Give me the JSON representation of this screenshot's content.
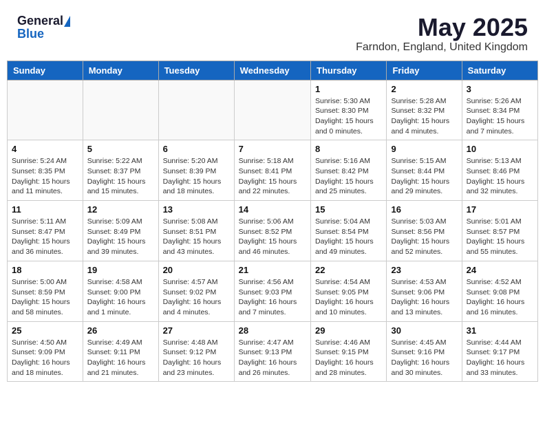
{
  "header": {
    "logo_general": "General",
    "logo_blue": "Blue",
    "month_title": "May 2025",
    "location": "Farndon, England, United Kingdom"
  },
  "weekdays": [
    "Sunday",
    "Monday",
    "Tuesday",
    "Wednesday",
    "Thursday",
    "Friday",
    "Saturday"
  ],
  "weeks": [
    [
      {
        "day": "",
        "info": ""
      },
      {
        "day": "",
        "info": ""
      },
      {
        "day": "",
        "info": ""
      },
      {
        "day": "",
        "info": ""
      },
      {
        "day": "1",
        "info": "Sunrise: 5:30 AM\nSunset: 8:30 PM\nDaylight: 15 hours and 0 minutes."
      },
      {
        "day": "2",
        "info": "Sunrise: 5:28 AM\nSunset: 8:32 PM\nDaylight: 15 hours and 4 minutes."
      },
      {
        "day": "3",
        "info": "Sunrise: 5:26 AM\nSunset: 8:34 PM\nDaylight: 15 hours and 7 minutes."
      }
    ],
    [
      {
        "day": "4",
        "info": "Sunrise: 5:24 AM\nSunset: 8:35 PM\nDaylight: 15 hours and 11 minutes."
      },
      {
        "day": "5",
        "info": "Sunrise: 5:22 AM\nSunset: 8:37 PM\nDaylight: 15 hours and 15 minutes."
      },
      {
        "day": "6",
        "info": "Sunrise: 5:20 AM\nSunset: 8:39 PM\nDaylight: 15 hours and 18 minutes."
      },
      {
        "day": "7",
        "info": "Sunrise: 5:18 AM\nSunset: 8:41 PM\nDaylight: 15 hours and 22 minutes."
      },
      {
        "day": "8",
        "info": "Sunrise: 5:16 AM\nSunset: 8:42 PM\nDaylight: 15 hours and 25 minutes."
      },
      {
        "day": "9",
        "info": "Sunrise: 5:15 AM\nSunset: 8:44 PM\nDaylight: 15 hours and 29 minutes."
      },
      {
        "day": "10",
        "info": "Sunrise: 5:13 AM\nSunset: 8:46 PM\nDaylight: 15 hours and 32 minutes."
      }
    ],
    [
      {
        "day": "11",
        "info": "Sunrise: 5:11 AM\nSunset: 8:47 PM\nDaylight: 15 hours and 36 minutes."
      },
      {
        "day": "12",
        "info": "Sunrise: 5:09 AM\nSunset: 8:49 PM\nDaylight: 15 hours and 39 minutes."
      },
      {
        "day": "13",
        "info": "Sunrise: 5:08 AM\nSunset: 8:51 PM\nDaylight: 15 hours and 43 minutes."
      },
      {
        "day": "14",
        "info": "Sunrise: 5:06 AM\nSunset: 8:52 PM\nDaylight: 15 hours and 46 minutes."
      },
      {
        "day": "15",
        "info": "Sunrise: 5:04 AM\nSunset: 8:54 PM\nDaylight: 15 hours and 49 minutes."
      },
      {
        "day": "16",
        "info": "Sunrise: 5:03 AM\nSunset: 8:56 PM\nDaylight: 15 hours and 52 minutes."
      },
      {
        "day": "17",
        "info": "Sunrise: 5:01 AM\nSunset: 8:57 PM\nDaylight: 15 hours and 55 minutes."
      }
    ],
    [
      {
        "day": "18",
        "info": "Sunrise: 5:00 AM\nSunset: 8:59 PM\nDaylight: 15 hours and 58 minutes."
      },
      {
        "day": "19",
        "info": "Sunrise: 4:58 AM\nSunset: 9:00 PM\nDaylight: 16 hours and 1 minute."
      },
      {
        "day": "20",
        "info": "Sunrise: 4:57 AM\nSunset: 9:02 PM\nDaylight: 16 hours and 4 minutes."
      },
      {
        "day": "21",
        "info": "Sunrise: 4:56 AM\nSunset: 9:03 PM\nDaylight: 16 hours and 7 minutes."
      },
      {
        "day": "22",
        "info": "Sunrise: 4:54 AM\nSunset: 9:05 PM\nDaylight: 16 hours and 10 minutes."
      },
      {
        "day": "23",
        "info": "Sunrise: 4:53 AM\nSunset: 9:06 PM\nDaylight: 16 hours and 13 minutes."
      },
      {
        "day": "24",
        "info": "Sunrise: 4:52 AM\nSunset: 9:08 PM\nDaylight: 16 hours and 16 minutes."
      }
    ],
    [
      {
        "day": "25",
        "info": "Sunrise: 4:50 AM\nSunset: 9:09 PM\nDaylight: 16 hours and 18 minutes."
      },
      {
        "day": "26",
        "info": "Sunrise: 4:49 AM\nSunset: 9:11 PM\nDaylight: 16 hours and 21 minutes."
      },
      {
        "day": "27",
        "info": "Sunrise: 4:48 AM\nSunset: 9:12 PM\nDaylight: 16 hours and 23 minutes."
      },
      {
        "day": "28",
        "info": "Sunrise: 4:47 AM\nSunset: 9:13 PM\nDaylight: 16 hours and 26 minutes."
      },
      {
        "day": "29",
        "info": "Sunrise: 4:46 AM\nSunset: 9:15 PM\nDaylight: 16 hours and 28 minutes."
      },
      {
        "day": "30",
        "info": "Sunrise: 4:45 AM\nSunset: 9:16 PM\nDaylight: 16 hours and 30 minutes."
      },
      {
        "day": "31",
        "info": "Sunrise: 4:44 AM\nSunset: 9:17 PM\nDaylight: 16 hours and 33 minutes."
      }
    ]
  ]
}
